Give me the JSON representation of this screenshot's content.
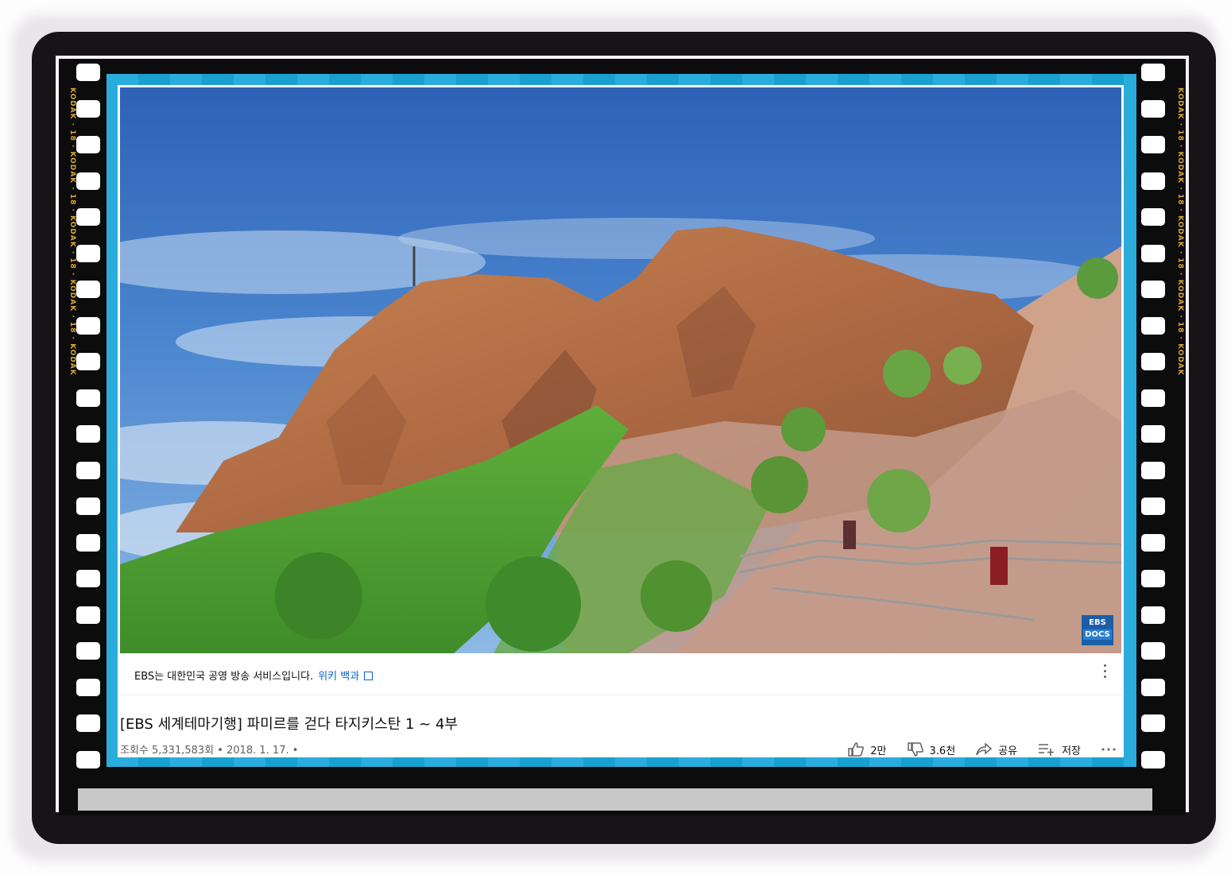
{
  "video": {
    "channel_logo_top": "EBS",
    "channel_logo_bottom": "DOCS"
  },
  "info_panel": {
    "text": "EBS는 대한민국 공영 방송 서비스입니다.",
    "link": "위키 백과"
  },
  "title": "[EBS 세계테마기행] 파미르를 걷다 타지키스탄 1 ~ 4부",
  "meta": "조회수 5,331,583회 • 2018. 1. 17. •",
  "actions": {
    "like_count": "2만",
    "dislike_count": "3.6천",
    "share_label": "공유",
    "save_label": "저장"
  },
  "film_edge_labels": [
    "KODAK",
    "KODAK",
    "KODAK",
    "KODAK",
    "KODAK",
    "KODAK",
    "KODAK",
    "KODAK",
    "KODAK",
    "KODAK"
  ],
  "colors": {
    "frame_blue": "#1aa6d9",
    "link_blue": "#065fd4",
    "film_black": "#0c0c0c",
    "edge_text": "#d9a43b"
  }
}
